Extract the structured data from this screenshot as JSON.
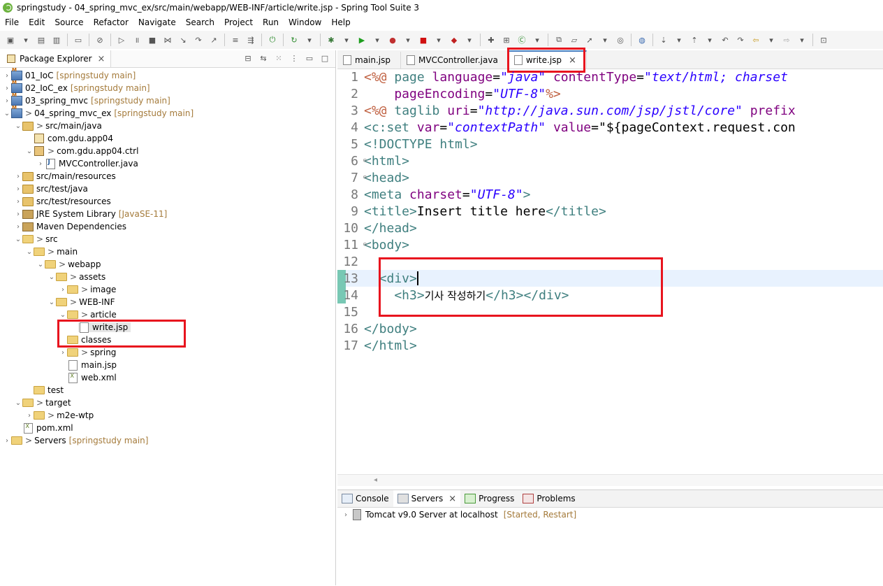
{
  "window": {
    "title": "springstudy - 04_spring_mvc_ex/src/main/webapp/WEB-INF/article/write.jsp - Spring Tool Suite 3"
  },
  "menu": [
    "File",
    "Edit",
    "Source",
    "Refactor",
    "Navigate",
    "Search",
    "Project",
    "Run",
    "Window",
    "Help"
  ],
  "package_explorer": {
    "tab_label": "Package Explorer",
    "tree": [
      {
        "label": "01_IoC",
        "suffix": "[springstudy main]"
      },
      {
        "label": "02_IoC_ex",
        "suffix": "[springstudy main]"
      },
      {
        "label": "03_spring_mvc",
        "suffix": "[springstudy main]"
      },
      {
        "label": "04_spring_mvc_ex",
        "suffix": "[springstudy main]"
      },
      {
        "label": "src/main/java"
      },
      {
        "label": "com.gdu.app04"
      },
      {
        "label": "com.gdu.app04.ctrl"
      },
      {
        "label": "MVCController.java"
      },
      {
        "label": "src/main/resources"
      },
      {
        "label": "src/test/java"
      },
      {
        "label": "src/test/resources"
      },
      {
        "label": "JRE System Library",
        "suffix": "[JavaSE-11]"
      },
      {
        "label": "Maven Dependencies"
      },
      {
        "label": "src"
      },
      {
        "label": "main"
      },
      {
        "label": "webapp"
      },
      {
        "label": "assets"
      },
      {
        "label": "image"
      },
      {
        "label": "WEB-INF"
      },
      {
        "label": "article"
      },
      {
        "label": "write.jsp"
      },
      {
        "label": "classes"
      },
      {
        "label": "spring"
      },
      {
        "label": "main.jsp"
      },
      {
        "label": "web.xml"
      },
      {
        "label": "test"
      },
      {
        "label": "target"
      },
      {
        "label": "m2e-wtp"
      },
      {
        "label": "pom.xml"
      },
      {
        "label": "Servers",
        "suffix": "[springstudy main]"
      }
    ]
  },
  "editor": {
    "tabs": [
      "main.jsp",
      "MVCController.java",
      "write.jsp"
    ],
    "lines": {
      "l1a": "<%@ ",
      "l1b": "page ",
      "l1c": "language",
      "l1d": "=",
      "l1e": "\"java\"",
      "l1f": " contentType",
      "l1g": "=",
      "l1h": "\"text/html; charset",
      "l2a": "    pageEncoding",
      "l2b": "=",
      "l2c": "\"UTF-8\"",
      "l2d": "%>",
      "l3a": "<%@ ",
      "l3b": "taglib ",
      "l3c": "uri",
      "l3d": "=",
      "l3e": "\"http://java.sun.com/jsp/jstl/core\"",
      "l3f": " prefix",
      "l4a": "<c:set ",
      "l4b": "var",
      "l4c": "=",
      "l4d": "\"contextPath\"",
      "l4e": " value",
      "l4f": "=",
      "l4g": "\"${pageContext.request.con",
      "l5": "<!DOCTYPE html>",
      "l6": "<html>",
      "l7": "<head>",
      "l8a": "<meta ",
      "l8b": "charset",
      "l8c": "=",
      "l8d": "\"UTF-8\"",
      "l8e": ">",
      "l9a": "<title>",
      "l9b": "Insert title here",
      "l9c": "</title>",
      "l10": "</head>",
      "l11": "<body>",
      "l12": "",
      "l13": "  <div>",
      "l14a": "    <h3>",
      "l14b": "기사 작성하기",
      "l14c": "</h3></div>",
      "l15": "",
      "l16": "</body>",
      "l17": "</html>"
    },
    "line_numbers": [
      "1",
      "2",
      "3",
      "4",
      "5",
      "6",
      "7",
      "8",
      "9",
      "10",
      "11",
      "12",
      "13",
      "14",
      "15",
      "16",
      "17"
    ]
  },
  "bottom": {
    "tabs": [
      "Console",
      "Servers",
      "Progress",
      "Problems"
    ],
    "server": {
      "name": "Tomcat v9.0 Server at localhost",
      "state": "[Started, Restart]"
    }
  },
  "colors": {
    "highlight_box": "#e8141e",
    "active_tab_accent": "#4a7fc0"
  }
}
